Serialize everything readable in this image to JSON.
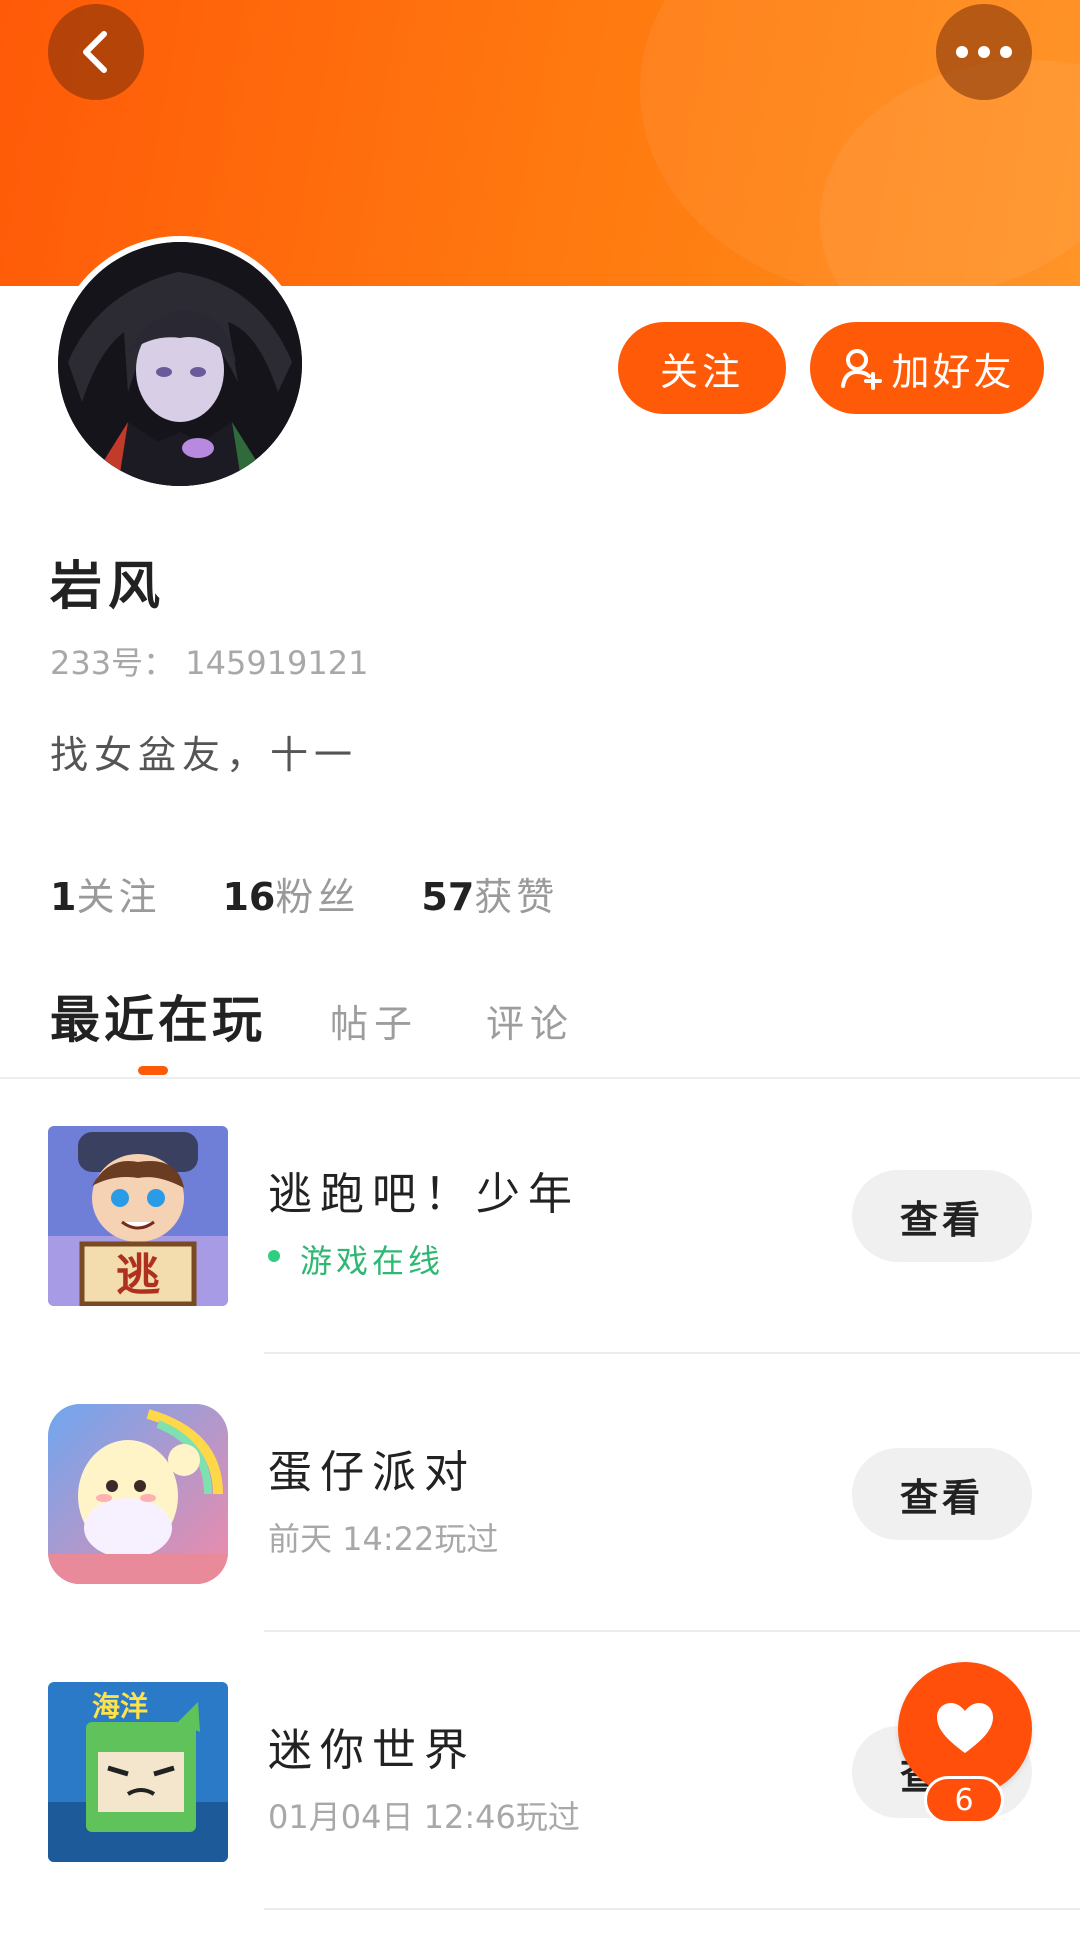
{
  "header": {
    "back_icon": "chevron-left-icon",
    "more_icon": "more-dots-icon"
  },
  "profile": {
    "username": "岩风",
    "user_id": "233号： 145919121",
    "bio": "找女盆友，十一",
    "follow_label": "关注",
    "add_friend_label": "加好友",
    "stats": [
      {
        "num": "1",
        "label": "关注"
      },
      {
        "num": "16",
        "label": "粉丝"
      },
      {
        "num": "57",
        "label": "获赞"
      }
    ]
  },
  "tabs": [
    {
      "label": "最近在玩",
      "active": true
    },
    {
      "label": "帖子",
      "active": false
    },
    {
      "label": "评论",
      "active": false
    }
  ],
  "games": [
    {
      "name": "逃跑吧！少年",
      "status": "游戏在线",
      "online": true,
      "action": "查看",
      "icon_text": "逃"
    },
    {
      "name": "蛋仔派对",
      "status": "前天 14:22玩过",
      "online": false,
      "action": "查看"
    },
    {
      "name": "迷你世界",
      "status": "01月04日 12:46玩过",
      "online": false,
      "action": "查看",
      "icon_text": "海洋"
    }
  ],
  "fab": {
    "icon": "heart-icon",
    "count": "6"
  },
  "colors": {
    "accent": "#ff5a08",
    "online": "#2fb873"
  }
}
